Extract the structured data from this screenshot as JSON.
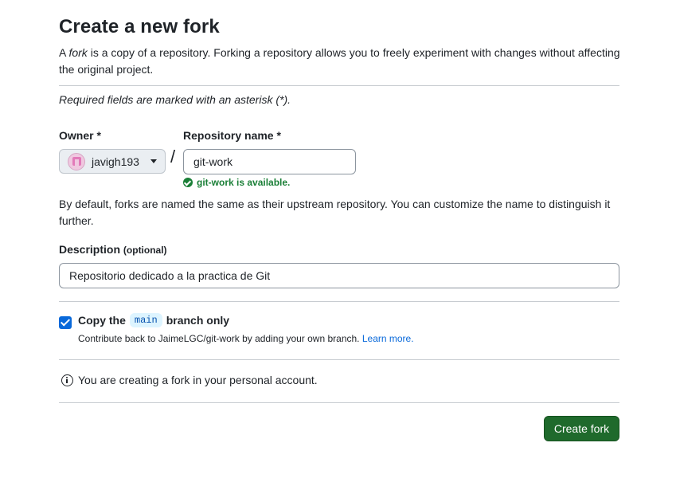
{
  "page": {
    "title": "Create a new fork",
    "intro_prefix": "A ",
    "intro_em": "fork",
    "intro_suffix": " is a copy of a repository. Forking a repository allows you to freely experiment with changes without affecting the original project.",
    "required_note": "Required fields are marked with an asterisk (*)."
  },
  "owner": {
    "label": "Owner *",
    "value": "javigh193"
  },
  "repository": {
    "label": "Repository name *",
    "value": "git-work",
    "availability": "git-work is available."
  },
  "default_note": "By default, forks are named the same as their upstream repository. You can customize the name to distinguish it further.",
  "description": {
    "label": "Description",
    "optional": "(optional)",
    "value": "Repositorio dedicado a la practica de Git"
  },
  "copy_branch": {
    "checked": true,
    "prefix": "Copy the",
    "branch": "main",
    "suffix": "branch only",
    "help_text": "Contribute back to JaimeLGC/git-work by adding your own branch.",
    "learn_more": "Learn more."
  },
  "info": {
    "icon": "info-icon",
    "text": "You are creating a fork in your personal account."
  },
  "actions": {
    "create_label": "Create fork"
  },
  "colors": {
    "primary_button": "#1f6a2c",
    "success": "#1a7f37",
    "accent": "#0969da"
  }
}
